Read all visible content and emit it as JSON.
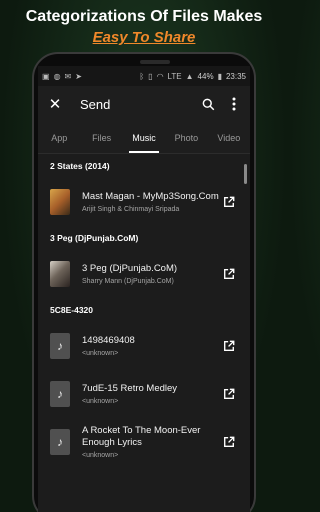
{
  "promo": {
    "line1": "Categorizations Of Files Makes",
    "line2": "Easy To Share"
  },
  "statusbar": {
    "battery_percent": "44%",
    "time": "23:35",
    "network": "LTE"
  },
  "appbar": {
    "title": "Send",
    "close_icon": "close-icon",
    "search_icon": "search-icon",
    "more_icon": "more-vert-icon"
  },
  "tabs": [
    {
      "label": "App"
    },
    {
      "label": "Files"
    },
    {
      "label": "Music",
      "active": true
    },
    {
      "label": "Photo"
    },
    {
      "label": "Video"
    }
  ],
  "sections": [
    {
      "header": "2 States (2014)",
      "items": [
        {
          "title": "Mast Magan - MyMp3Song.Com",
          "subtitle": "Arijit Singh & Chinmayi Sripada",
          "thumb": "album-art"
        }
      ]
    },
    {
      "header": "3 Peg (DjPunjab.CoM)",
      "items": [
        {
          "title": "3 Peg (DjPunjab.CoM)",
          "subtitle": "Sharry Mann (DjPunjab.CoM)",
          "thumb": "album-art"
        }
      ]
    },
    {
      "header": "5C8E-4320",
      "items": [
        {
          "title": "1498469408",
          "subtitle": "<unknown>",
          "thumb": "music-note-icon"
        },
        {
          "title": "7udE-15 Retro Medley",
          "subtitle": "<unknown>",
          "thumb": "music-note-icon"
        },
        {
          "title": "A Rocket To The Moon-Ever Enough Lyrics",
          "subtitle": "<unknown>",
          "thumb": "music-note-icon"
        }
      ]
    }
  ],
  "colors": {
    "accent": "#f0882a",
    "background": "#1c1c1c",
    "tab_indicator": "#ffffff"
  }
}
